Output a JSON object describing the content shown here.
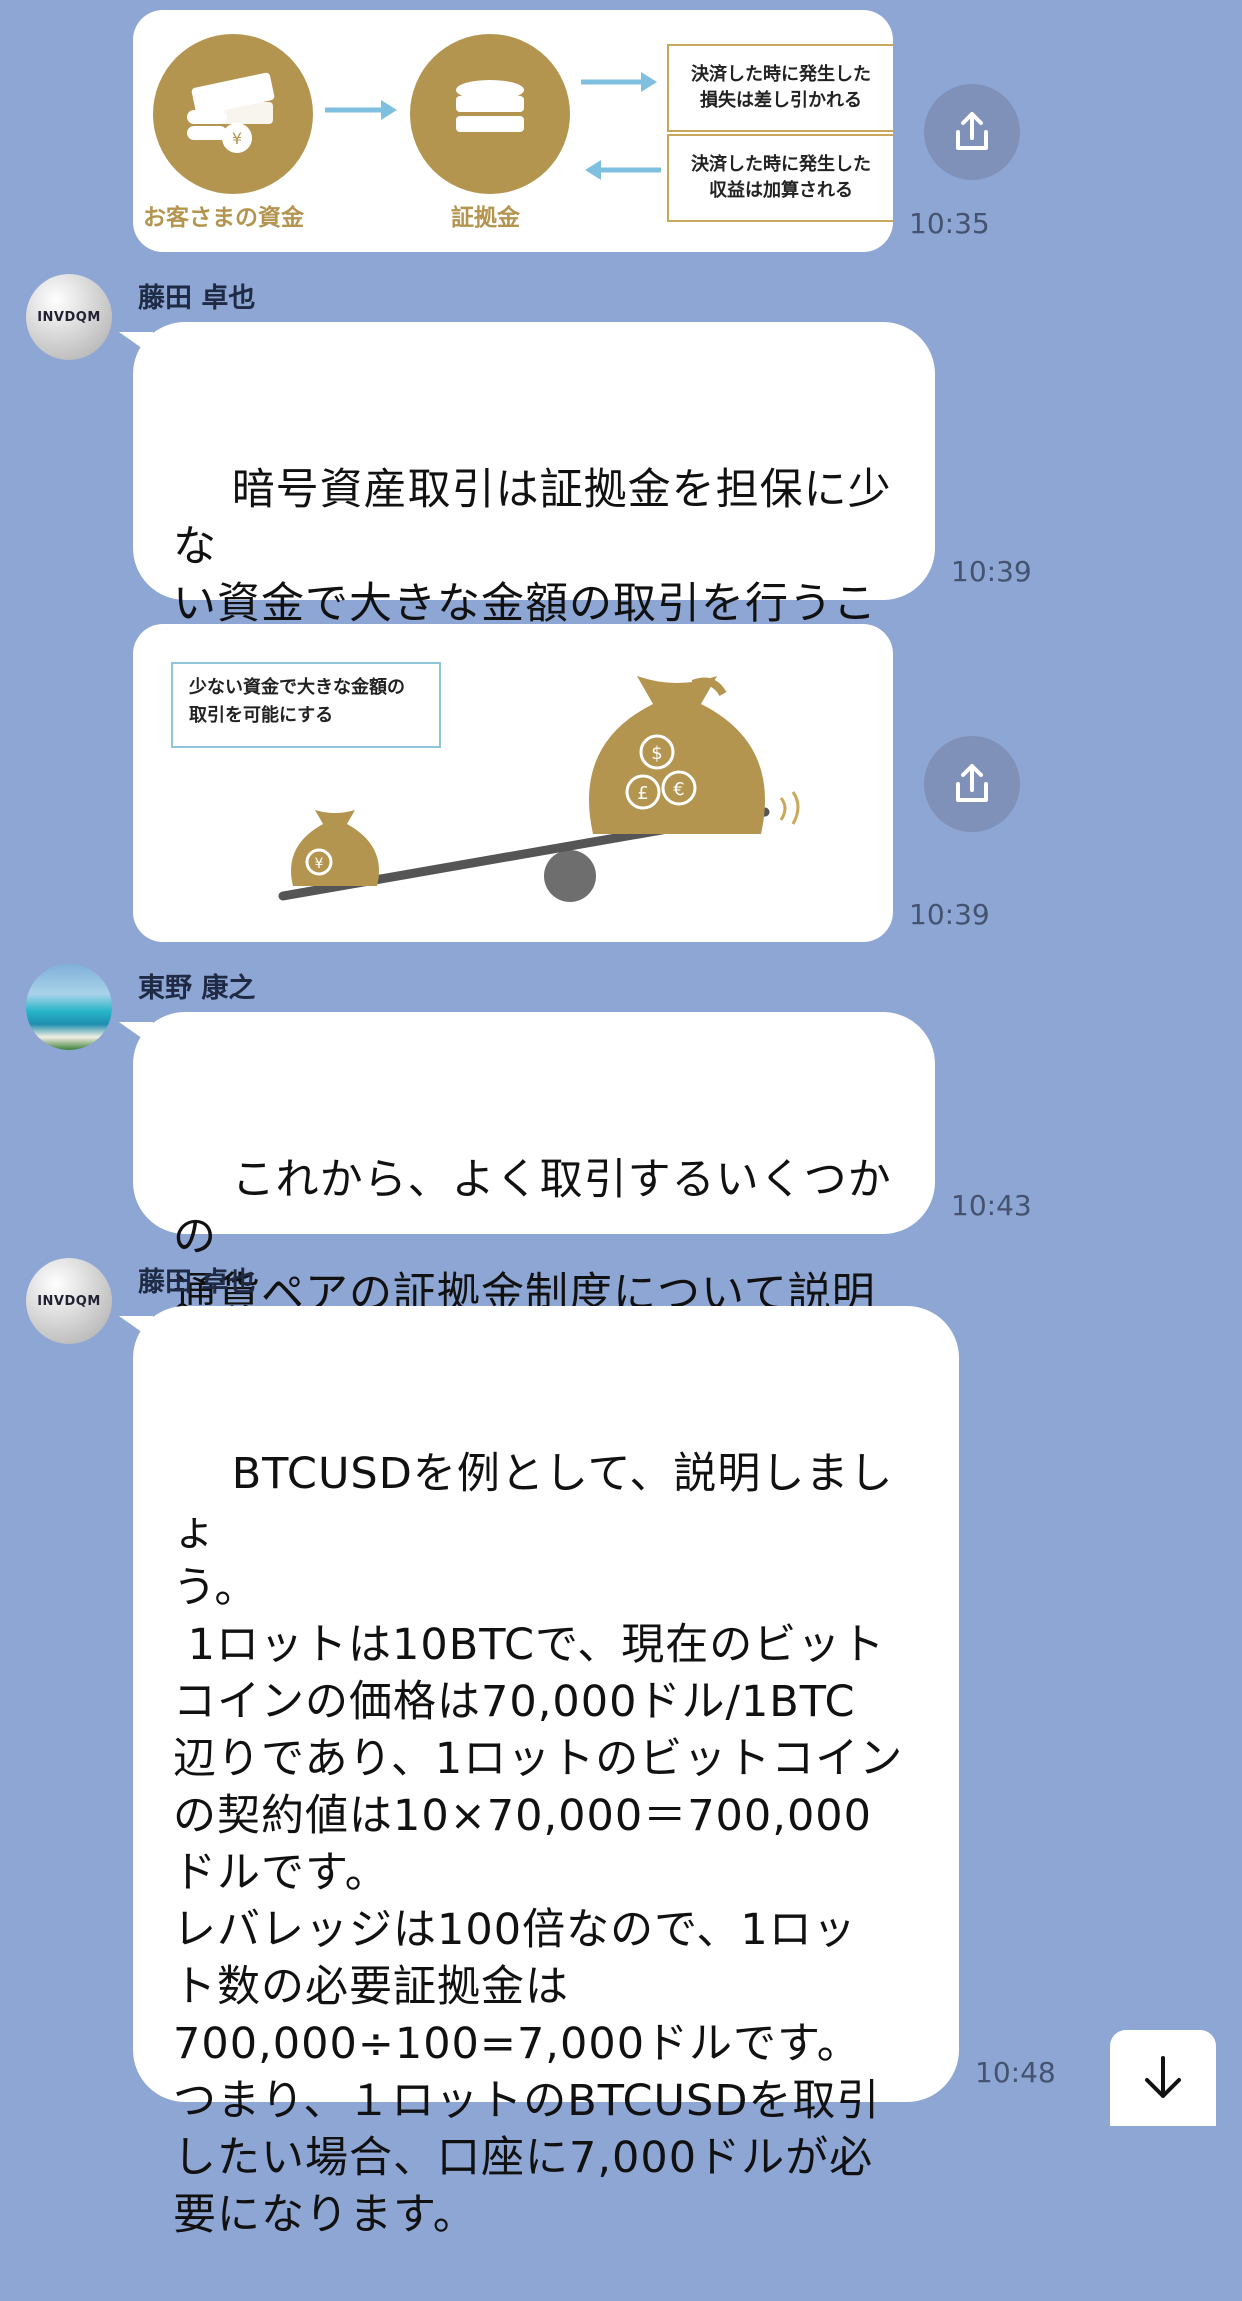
{
  "colors": {
    "background": "#8ea6d4",
    "bubble": "#ffffff",
    "gold": "#b49550",
    "arrow_blue": "#7fc0e0",
    "share_button": "#7f91b8"
  },
  "messages": {
    "img1": {
      "caption_funds": "お客さまの資金",
      "caption_margin": "証拠金",
      "box_loss": "決済した時に発生した\n損失は差し引かれる",
      "box_gain": "決済した時に発生した\n収益は加算される",
      "time": "10:35"
    },
    "msg1": {
      "sender": "藤田 卓也",
      "avatar_text": "INVDQM",
      "text": "暗号資産取引は証拠金を担保に少な\nい資金で大きな金額の取引を行うこ\nとができます。\nこれをレバレッジ取引といいます。",
      "time": "10:39"
    },
    "img2": {
      "box_text": "少ない資金で大きな金額の\n取引を可能にする",
      "time": "10:39"
    },
    "msg2": {
      "sender": "東野 康之",
      "text": "これから、よく取引するいくつかの\n通貨ペアの証拠金制度について説明\nします。",
      "time": "10:43"
    },
    "msg3": {
      "sender": "藤田 卓也",
      "avatar_text": "INVDQM",
      "text": "BTCUSDを例として、説明しましょ\nう。\n 1ロットは10BTCで、現在のビット\nコインの価格は70,000ドル/1BTC\n辺りであり、1ロットのビットコイン\nの契約値は10×70,000＝700,000\nドルです。\nレバレッジは100倍なので、1ロッ\nト数の必要証拠金は\n700,000÷100=7,000ドルです。\nつまり、１ロットのBTCUSDを取引\nしたい場合、口座に7,000ドルが必\n要になります。",
      "time": "10:48"
    }
  },
  "icons": {
    "share": "share-icon",
    "scroll_down": "arrow-down-icon"
  }
}
